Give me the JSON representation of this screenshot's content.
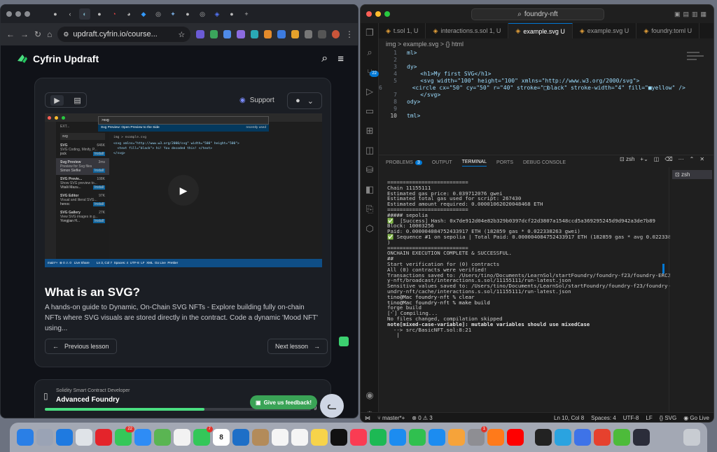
{
  "browser": {
    "url": "updraft.cyfrin.io/course...",
    "brand": "Cyfrin Updraft",
    "support_label": "Support",
    "video": {
      "cmd_input": ">svg",
      "cmd_suggestion": "Svg Preview: Open Preview to the Side",
      "cmd_hint": "recently used",
      "sidebar_title": "EXT...",
      "sidebar_search": "svg",
      "extensions": [
        {
          "name": "SVG",
          "desc": "SVG Coding, Minify, P...",
          "author": "jock",
          "count": "646K"
        },
        {
          "name": "Svg Preview",
          "desc": "Preview for Svg files",
          "author": "Simon Siefke",
          "count": "3ms"
        },
        {
          "name": "SVG Previe...",
          "desc": "Show SVG preview to...",
          "author": "Vitalii Mazu...",
          "count": "108K"
        },
        {
          "name": "SVG Editor",
          "desc": "Visual and literal SVG...",
          "author": "henoc",
          "count": "97K"
        },
        {
          "name": "SVG Gallery",
          "desc": "View SVG images in g...",
          "author": "Yongjian H...",
          "count": "27K"
        }
      ],
      "install_label": "Install",
      "breadcrumb": "img > example.svg",
      "code": [
        "<svg xmlns=\"http://www.w3.org/2000/svg\" width=\"500\" height=\"500\">",
        "  <text fill=\"black\"> hi! You decoded this! </text>",
        "</svg>"
      ],
      "status": "main*+  ⊗ 0 ⚠ 0   Live Share        Ln 3, Col 7  Spaces: 4  UTF-8  LF  XML  Go Live  Prettier"
    },
    "lesson_title": "What is an SVG?",
    "lesson_desc": "A hands-on guide to Dynamic, On-Chain SVG NFTs - Explore building fully on-chain NFTs where SVG visuals are stored directly in the contract. Code a dynamic 'Mood NFT' using...",
    "prev_label": "Previous lesson",
    "next_label": "Next lesson",
    "course_kicker": "Solidity Smart Contract Developer",
    "course_name": "Advanced Foundry",
    "course_progress": 0.6,
    "course_pct_partial": "9",
    "feedback_label": "Give us feedback!"
  },
  "vscode": {
    "search": "foundry-nft",
    "tabs": [
      {
        "label": "t.sol 1, U",
        "active": false
      },
      {
        "label": "interactions.s.sol 1, U",
        "active": false
      },
      {
        "label": "example.svg U",
        "active": true
      },
      {
        "label": "example.svg U",
        "active": false
      },
      {
        "label": "foundry.toml U",
        "active": false
      }
    ],
    "breadcrumb": "img  >  example.svg  >  {} html",
    "code_lines": [
      {
        "n": "1",
        "t": "ml>"
      },
      {
        "n": "2",
        "t": ""
      },
      {
        "n": "3",
        "t": "dy>"
      },
      {
        "n": "4",
        "t": "    <h1>My first SVG</h1>"
      },
      {
        "n": "5",
        "t": "    <svg width=\"100\" height=\"100\" xmlns=\"http://www.w3.org/2000/svg\">"
      },
      {
        "n": "6",
        "t": "      <circle cx=\"50\" cy=\"50\" r=\"40\" stroke=\"□black\" stroke-width=\"4\" fill=\"■yellow\" />"
      },
      {
        "n": "7",
        "t": "    </svg>"
      },
      {
        "n": "8",
        "t": "ody>"
      },
      {
        "n": "9",
        "t": ""
      },
      {
        "n": "10",
        "t": "tml>"
      }
    ],
    "panel_tabs": [
      "PROBLEMS",
      "OUTPUT",
      "TERMINAL",
      "PORTS",
      "DEBUG CONSOLE"
    ],
    "problems_count": "3",
    "terminal_shell": "zsh",
    "terminal_lines": [
      "==========================",
      "",
      "Chain 11155111",
      "",
      "Estimated gas price: 0.039712076 gwei",
      "",
      "Estimated total gas used for script: 267430",
      "",
      "Estimated amount required: 0.00001062020048468 ETH",
      "",
      "==========================",
      "",
      "##### sepolia",
      "✅  [Success] Hash: 0x7de912d04e82b329b0397dcf22d3807a1548ccd5a369295245d9d942a3de7b89",
      "Block: 10003256",
      "Paid: 0.000004084752433917 ETH (182859 gas * 0.022338263 gwei)",
      "",
      "✅ Sequence #1 on sepolia | Total Paid: 0.000004084752433917 ETH (182859 gas * avg 0.022338263 gwei",
      ")",
      "",
      "==========================",
      "",
      "ONCHAIN EXECUTION COMPLETE & SUCCESSFUL.",
      "##",
      "Start verification for (0) contracts",
      "All (0) contracts were verified!",
      "",
      "Transactions saved to: /Users/tino/Documents/LearnSol/startFoundry/foundry-f23/foundry-ERC20/foundr",
      "y-nft/broadcast/interactions.s.sol/11155111/run-latest.json",
      "",
      "Sensitive values saved to: /Users/tino/Documents/LearnSol/startFoundry/foundry-f23/foundry-ERC20/fo",
      "undry-nft/cache/interactions.s.sol/11155111/run-latest.json",
      "",
      "tino@Mac foundry-nft % clear",
      "tino@Mac foundry-nft % make build",
      "forge build",
      "[⠊] Compiling...",
      "No files changed, compilation skipped",
      "note[mixed-case-variable]: mutable variables should use mixedCase",
      "  --> src/BasicNFT.sol:8:21",
      "   |"
    ],
    "status": {
      "branch": "master*+",
      "errors": "0",
      "warnings": "3",
      "position": "Ln 10, Col 8",
      "spaces": "Spaces: 4",
      "encoding": "UTF-8",
      "eol": "LF",
      "lang": "SVG",
      "golive": "Go Live"
    }
  },
  "dock": {
    "apps": [
      {
        "icon": "finder-icon",
        "color": "#2a7fe6"
      },
      {
        "icon": "launchpad-icon",
        "color": "#9aa3b5"
      },
      {
        "icon": "safari-icon",
        "color": "#1f7ae0"
      },
      {
        "icon": "chrome-icon",
        "color": "#dfe3e8"
      },
      {
        "icon": "opera-icon",
        "color": "#e4242b"
      },
      {
        "icon": "messages-icon",
        "color": "#35c759",
        "badge": "22"
      },
      {
        "icon": "mail-icon",
        "color": "#2e8cf5"
      },
      {
        "icon": "maps-icon",
        "color": "#5ab552"
      },
      {
        "icon": "photos-icon",
        "color": "#f2f2f2"
      },
      {
        "icon": "facetime-icon",
        "color": "#34c759",
        "badge": "7"
      },
      {
        "icon": "calendar-icon",
        "color": "#ffffff",
        "label": "8"
      },
      {
        "icon": "vscode-icon",
        "color": "#1e6fc7"
      },
      {
        "icon": "contacts-icon",
        "color": "#b38b5a"
      },
      {
        "icon": "reminders-icon",
        "color": "#f5f5f5"
      },
      {
        "icon": "freeform-icon",
        "color": "#f5f5f5"
      },
      {
        "icon": "notes-icon",
        "color": "#f7d34a"
      },
      {
        "icon": "tv-icon",
        "color": "#111111"
      },
      {
        "icon": "music-icon",
        "color": "#fa3c53"
      },
      {
        "icon": "spotify-icon",
        "color": "#1db954"
      },
      {
        "icon": "keynote-icon",
        "color": "#1c8cf0"
      },
      {
        "icon": "numbers-icon",
        "color": "#30c04f"
      },
      {
        "icon": "appstore-icon",
        "color": "#1c8cf0"
      },
      {
        "icon": "pages-icon",
        "color": "#f6a33a"
      },
      {
        "icon": "settings-icon",
        "color": "#8e8e93",
        "badge": "1"
      },
      {
        "icon": "books-icon",
        "color": "#ff7a1a"
      },
      {
        "icon": "youtube-icon",
        "color": "#ff0000"
      },
      {
        "icon": "terminal-icon",
        "color": "#222222"
      },
      {
        "icon": "telegram-icon",
        "color": "#2aa3e0"
      },
      {
        "icon": "canva-icon",
        "color": "#3e73e8"
      },
      {
        "icon": "wps-icon",
        "color": "#e6412e"
      },
      {
        "icon": "green-app-icon",
        "color": "#4dbb3a"
      },
      {
        "icon": "cat-app-icon",
        "color": "#2b2d3a"
      },
      {
        "icon": "trash-icon",
        "color": "#c8ccd2"
      }
    ]
  },
  "colors": {
    "accent": "#0078d4",
    "brand_green": "#4ade80",
    "feedback": "#3aa356"
  }
}
